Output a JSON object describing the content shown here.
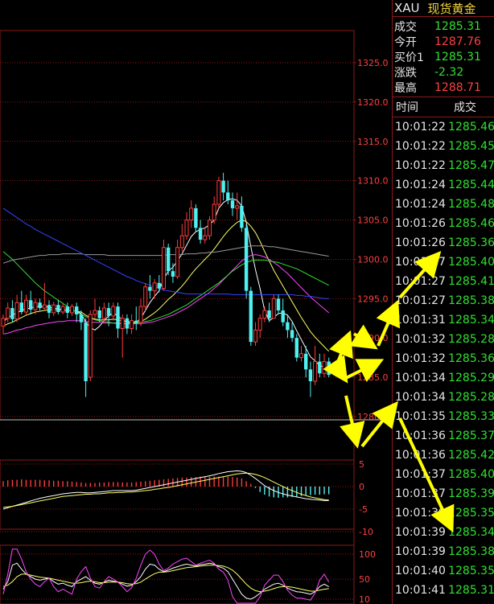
{
  "axis": {
    "main_ticks": [
      "1325.0",
      "1320.0",
      "1315.0",
      "1310.0",
      "1305.0",
      "1300.0",
      "1295.0",
      "1290.0",
      "1285.0",
      "1280.0"
    ],
    "macd_ticks": [
      "5",
      "0",
      "-5",
      "-10"
    ],
    "kdj_ticks": [
      "100",
      "50",
      "10"
    ]
  },
  "panel": {
    "symbol": "XAU",
    "name": "现货黄金",
    "quotes": [
      {
        "label": "成交",
        "value": "1285.31",
        "color": "#33e033"
      },
      {
        "label": "今开",
        "value": "1287.76",
        "color": "#ff4040"
      },
      {
        "label": "买价1",
        "value": "1285.31",
        "color": "#33e033"
      },
      {
        "label": "涨跌",
        "value": "-2.32",
        "color": "#33e033"
      },
      {
        "label": "最高",
        "value": "1288.71",
        "color": "#ff4040"
      }
    ],
    "ticks_header": {
      "time": "时间",
      "price": "成交"
    },
    "ticks": [
      {
        "time": "10:01:22",
        "price": "1285.46"
      },
      {
        "time": "10:01:22",
        "price": "1285.45"
      },
      {
        "time": "10:01:22",
        "price": "1285.47"
      },
      {
        "time": "10:01:24",
        "price": "1285.44"
      },
      {
        "time": "10:01:24",
        "price": "1285.48"
      },
      {
        "time": "10:01:26",
        "price": "1285.46"
      },
      {
        "time": "10:01:26",
        "price": "1285.36"
      },
      {
        "time": "10:01:27",
        "price": "1285.40"
      },
      {
        "time": "10:01:27",
        "price": "1285.41"
      },
      {
        "time": "10:01:27",
        "price": "1285.38"
      },
      {
        "time": "10:01:31",
        "price": "1285.34"
      },
      {
        "time": "10:01:32",
        "price": "1285.28"
      },
      {
        "time": "10:01:32",
        "price": "1285.36"
      },
      {
        "time": "10:01:34",
        "price": "1285.29"
      },
      {
        "time": "10:01:34",
        "price": "1285.28"
      },
      {
        "time": "10:01:35",
        "price": "1285.33"
      },
      {
        "time": "10:01:36",
        "price": "1285.37"
      },
      {
        "time": "10:01:36",
        "price": "1285.42"
      },
      {
        "time": "10:01:37",
        "price": "1285.40"
      },
      {
        "time": "10:01:37",
        "price": "1285.39"
      },
      {
        "time": "10:01:39",
        "price": "1285.35"
      },
      {
        "time": "10:01:39",
        "price": "1285.34"
      },
      {
        "time": "10:01:39",
        "price": "1285.38"
      },
      {
        "time": "10:01:40",
        "price": "1285.35"
      },
      {
        "time": "10:01:41",
        "price": "1285.31"
      }
    ]
  },
  "colors": {
    "up": "#ff3b3b",
    "down": "#4ff0f0",
    "grid": "#8b1a1a",
    "ma_white": "#ffffff",
    "ma_yellow": "#ffff66",
    "ma_magenta": "#ff44ff",
    "ma_green": "#33dd33",
    "ma_gray": "#999999",
    "ma_blue": "#3344ff",
    "arrow": "#ffff00"
  },
  "candles": [
    {
      "o": 1291.5,
      "c": 1292.5,
      "h": 1293,
      "l": 1290.5
    },
    {
      "o": 1292.5,
      "c": 1293.8,
      "h": 1294.5,
      "l": 1292
    },
    {
      "o": 1293.8,
      "c": 1292.4,
      "h": 1294.8,
      "l": 1292
    },
    {
      "o": 1292.4,
      "c": 1294.5,
      "h": 1295.5,
      "l": 1292
    },
    {
      "o": 1294.5,
      "c": 1293.3,
      "h": 1296,
      "l": 1293
    },
    {
      "o": 1293.3,
      "c": 1294.8,
      "h": 1295.5,
      "l": 1293
    },
    {
      "o": 1294.8,
      "c": 1293.6,
      "h": 1296,
      "l": 1293
    },
    {
      "o": 1293.6,
      "c": 1294.5,
      "h": 1295,
      "l": 1293
    },
    {
      "o": 1294.5,
      "c": 1293.8,
      "h": 1295,
      "l": 1293.5
    },
    {
      "o": 1293.8,
      "c": 1294.2,
      "h": 1297,
      "l": 1293.5
    },
    {
      "o": 1294.2,
      "c": 1293.2,
      "h": 1294.8,
      "l": 1292.5
    },
    {
      "o": 1293.2,
      "c": 1294.2,
      "h": 1294.6,
      "l": 1292.8
    },
    {
      "o": 1294.2,
      "c": 1293.3,
      "h": 1294.8,
      "l": 1293
    },
    {
      "o": 1293.3,
      "c": 1294,
      "h": 1294.5,
      "l": 1293
    },
    {
      "o": 1294,
      "c": 1293.2,
      "h": 1294.5,
      "l": 1292.5
    },
    {
      "o": 1293.2,
      "c": 1294,
      "h": 1294.3,
      "l": 1292.8
    },
    {
      "o": 1294,
      "c": 1293,
      "h": 1294.5,
      "l": 1292
    },
    {
      "o": 1293,
      "c": 1292,
      "h": 1293.5,
      "l": 1291
    },
    {
      "o": 1292,
      "c": 1284.5,
      "h": 1292.5,
      "l": 1282.5
    },
    {
      "o": 1285,
      "c": 1293,
      "h": 1293.5,
      "l": 1284.5
    },
    {
      "o": 1293,
      "c": 1293.5,
      "h": 1295,
      "l": 1292.5
    },
    {
      "o": 1293.5,
      "c": 1292.5,
      "h": 1294,
      "l": 1292
    },
    {
      "o": 1292.5,
      "c": 1293.8,
      "h": 1294.5,
      "l": 1292
    },
    {
      "o": 1293.8,
      "c": 1292.8,
      "h": 1294.5,
      "l": 1291.5
    },
    {
      "o": 1292.8,
      "c": 1294,
      "h": 1294.5,
      "l": 1292.2
    },
    {
      "o": 1294,
      "c": 1291.2,
      "h": 1294.5,
      "l": 1290
    },
    {
      "o": 1291.2,
      "c": 1292.5,
      "h": 1293,
      "l": 1287.5
    },
    {
      "o": 1292.5,
      "c": 1291.2,
      "h": 1293,
      "l": 1290.5
    },
    {
      "o": 1291.2,
      "c": 1292.2,
      "h": 1293,
      "l": 1290.5
    },
    {
      "o": 1292.2,
      "c": 1292,
      "h": 1294,
      "l": 1291
    },
    {
      "o": 1292,
      "c": 1294,
      "h": 1295,
      "l": 1291.5
    },
    {
      "o": 1294,
      "c": 1296.5,
      "h": 1297,
      "l": 1293.5
    },
    {
      "o": 1296.5,
      "c": 1296,
      "h": 1298,
      "l": 1295
    },
    {
      "o": 1296,
      "c": 1297,
      "h": 1297.5,
      "l": 1295
    },
    {
      "o": 1297,
      "c": 1296.3,
      "h": 1298,
      "l": 1295.8
    },
    {
      "o": 1296.3,
      "c": 1301.5,
      "h": 1302.5,
      "l": 1296
    },
    {
      "o": 1301.5,
      "c": 1298.5,
      "h": 1302,
      "l": 1298
    },
    {
      "o": 1298.5,
      "c": 1297.8,
      "h": 1299.5,
      "l": 1297
    },
    {
      "o": 1297.8,
      "c": 1301.5,
      "h": 1302.5,
      "l": 1297.5
    },
    {
      "o": 1301.5,
      "c": 1303,
      "h": 1304.5,
      "l": 1301
    },
    {
      "o": 1303,
      "c": 1305,
      "h": 1306,
      "l": 1302.5
    },
    {
      "o": 1305,
      "c": 1306.5,
      "h": 1307.5,
      "l": 1304
    },
    {
      "o": 1306.5,
      "c": 1304,
      "h": 1307,
      "l": 1303.5
    },
    {
      "o": 1304,
      "c": 1302.5,
      "h": 1305,
      "l": 1302
    },
    {
      "o": 1302.5,
      "c": 1303,
      "h": 1304,
      "l": 1302
    },
    {
      "o": 1303,
      "c": 1305,
      "h": 1305.5,
      "l": 1302.5
    },
    {
      "o": 1305,
      "c": 1307,
      "h": 1308,
      "l": 1304.5
    },
    {
      "o": 1307,
      "c": 1310,
      "h": 1310.5,
      "l": 1306.5
    },
    {
      "o": 1310,
      "c": 1308.5,
      "h": 1311,
      "l": 1307.5
    },
    {
      "o": 1308.5,
      "c": 1307.5,
      "h": 1310,
      "l": 1307
    },
    {
      "o": 1307.5,
      "c": 1306.5,
      "h": 1308.5,
      "l": 1305.5
    },
    {
      "o": 1306.5,
      "c": 1306.8,
      "h": 1308.5,
      "l": 1305
    },
    {
      "o": 1306.8,
      "c": 1304,
      "h": 1308,
      "l": 1303.5
    },
    {
      "o": 1304,
      "c": 1296,
      "h": 1304.5,
      "l": 1295
    },
    {
      "o": 1296,
      "c": 1289.5,
      "h": 1296.5,
      "l": 1289
    },
    {
      "o": 1289.5,
      "c": 1291,
      "h": 1292,
      "l": 1289
    },
    {
      "o": 1291,
      "c": 1292.5,
      "h": 1293,
      "l": 1290
    },
    {
      "o": 1292.5,
      "c": 1293.5,
      "h": 1294,
      "l": 1292
    },
    {
      "o": 1293.5,
      "c": 1292.5,
      "h": 1294.5,
      "l": 1292
    },
    {
      "o": 1292.5,
      "c": 1295,
      "h": 1295.5,
      "l": 1292.5
    },
    {
      "o": 1295,
      "c": 1293.5,
      "h": 1295.5,
      "l": 1293
    },
    {
      "o": 1293.5,
      "c": 1292,
      "h": 1295,
      "l": 1291.5
    },
    {
      "o": 1292,
      "c": 1291,
      "h": 1293,
      "l": 1290
    },
    {
      "o": 1291,
      "c": 1290,
      "h": 1292,
      "l": 1289.5
    },
    {
      "o": 1290,
      "c": 1287.5,
      "h": 1290.5,
      "l": 1287
    },
    {
      "o": 1287.5,
      "c": 1288,
      "h": 1289,
      "l": 1287
    },
    {
      "o": 1288,
      "c": 1286,
      "h": 1289,
      "l": 1285
    },
    {
      "o": 1286,
      "c": 1284.5,
      "h": 1287,
      "l": 1282.5
    },
    {
      "o": 1284.5,
      "c": 1287,
      "h": 1289,
      "l": 1284
    },
    {
      "o": 1287,
      "c": 1285.5,
      "h": 1288,
      "l": 1285
    },
    {
      "o": 1285.5,
      "c": 1287,
      "h": 1288,
      "l": 1285
    },
    {
      "o": 1287,
      "c": 1285.3,
      "h": 1287.5,
      "l": 1285
    }
  ],
  "ma_series": {
    "white": [
      1292,
      1292.6,
      1292.9,
      1293.2,
      1293.5,
      1293.7,
      1293.8,
      1294,
      1294,
      1294,
      1293.9,
      1293.8,
      1293.7,
      1293.6,
      1293.5,
      1293.5,
      1293.4,
      1293.1,
      1292,
      1291.3,
      1291,
      1291.5,
      1292.2,
      1292.8,
      1293.2,
      1292.8,
      1292.3,
      1292,
      1291.9,
      1292,
      1292.5,
      1293.5,
      1294.5,
      1295.3,
      1296,
      1297.5,
      1298.5,
      1299,
      1299.8,
      1300.7,
      1301.8,
      1302.9,
      1303.5,
      1303.8,
      1304,
      1304.4,
      1305,
      1306.5,
      1307.2,
      1307.6,
      1307.7,
      1307.5,
      1306.8,
      1304.7,
      1301.6,
      1298.7,
      1296.3,
      1293.5,
      1292.2,
      1292.6,
      1293.1,
      1293.2,
      1292.9,
      1292.1,
      1290.9,
      1289.8,
      1288.7,
      1287.6,
      1287.1,
      1286.5,
      1286.3,
      1286
    ],
    "yellow": [
      1291.5,
      1291.8,
      1292,
      1292.3,
      1292.6,
      1292.9,
      1293.1,
      1293.3,
      1293.4,
      1293.5,
      1293.6,
      1293.6,
      1293.6,
      1293.6,
      1293.5,
      1293.5,
      1293.4,
      1293.3,
      1292.9,
      1292.6,
      1292.4,
      1292.3,
      1292.3,
      1292.3,
      1292.4,
      1292.3,
      1292.2,
      1292.1,
      1292,
      1292,
      1292.1,
      1292.4,
      1292.8,
      1293.2,
      1293.7,
      1294.3,
      1294.9,
      1295.4,
      1296,
      1296.6,
      1297.3,
      1298.1,
      1298.8,
      1299.4,
      1300,
      1300.6,
      1301.3,
      1302.1,
      1302.9,
      1303.6,
      1304.2,
      1304.7,
      1305,
      1304.8,
      1304.2,
      1303.4,
      1302.3,
      1301,
      1299.8,
      1298.6,
      1297.6,
      1296.6,
      1295.6,
      1294.6,
      1293.6,
      1292.6,
      1291.7,
      1290.8,
      1290.1,
      1289.5,
      1288.9,
      1288.3
    ],
    "magenta": [
      1290.5,
      1290.6,
      1290.8,
      1291,
      1291.1,
      1291.3,
      1291.4,
      1291.6,
      1291.7,
      1291.8,
      1291.9,
      1292,
      1292.1,
      1292.1,
      1292.2,
      1292.2,
      1292.2,
      1292.2,
      1292.1,
      1292,
      1292,
      1292,
      1291.9,
      1291.9,
      1291.9,
      1291.9,
      1291.9,
      1291.8,
      1291.8,
      1291.8,
      1291.8,
      1291.9,
      1292,
      1292.1,
      1292.3,
      1292.5,
      1292.7,
      1292.9,
      1293.2,
      1293.5,
      1293.8,
      1294.2,
      1294.6,
      1295,
      1295.4,
      1295.8,
      1296.3,
      1296.8,
      1297.4,
      1298,
      1298.6,
      1299.2,
      1299.8,
      1300.2,
      1300.5,
      1300.6,
      1300.5,
      1300.3,
      1300,
      1299.6,
      1299.2,
      1298.7,
      1298.2,
      1297.6,
      1297,
      1296.4,
      1295.8,
      1295.2,
      1294.7,
      1294.2,
      1293.7,
      1293.2
    ],
    "green": [
      1301,
      1300.5,
      1300,
      1299.4,
      1298.8,
      1298.2,
      1297.6,
      1297,
      1296.5,
      1296,
      1295.6,
      1295.2,
      1294.8,
      1294.4,
      1294,
      1293.6,
      1293.3,
      1293,
      1292.7,
      1292.5,
      1292.3,
      1292.2,
      1292.1,
      1292,
      1291.9,
      1291.8,
      1291.8,
      1291.8,
      1291.8,
      1291.9,
      1292,
      1292.1,
      1292.2,
      1292.4,
      1292.6,
      1292.8,
      1293,
      1293.3,
      1293.6,
      1293.9,
      1294.2,
      1294.6,
      1295,
      1295.4,
      1295.8,
      1296.2,
      1296.6,
      1297,
      1297.5,
      1298,
      1298.5,
      1298.9,
      1299.3,
      1299.6,
      1299.8,
      1299.9,
      1299.9,
      1299.9,
      1299.8,
      1299.7,
      1299.6,
      1299.4,
      1299.2,
      1299,
      1298.8,
      1298.5,
      1298.2,
      1297.9,
      1297.6,
      1297.3,
      1297,
      1296.7
    ],
    "gray": [
      1299.5,
      1299.7,
      1299.9,
      1300,
      1300.1,
      1300.2,
      1300.3,
      1300.4,
      1300.5,
      1300.5,
      1300.6,
      1300.6,
      1300.6,
      1300.7,
      1300.7,
      1300.7,
      1300.7,
      1300.7,
      1300.6,
      1300.6,
      1300.6,
      1300.6,
      1300.6,
      1300.5,
      1300.5,
      1300.5,
      1300.5,
      1300.5,
      1300.5,
      1300.5,
      1300.5,
      1300.5,
      1300.5,
      1300.5,
      1300.5,
      1300.5,
      1300.6,
      1300.6,
      1300.6,
      1300.6,
      1300.7,
      1300.7,
      1300.7,
      1300.8,
      1300.8,
      1300.9,
      1300.9,
      1301,
      1301.1,
      1301.2,
      1301.3,
      1301.4,
      1301.5,
      1301.6,
      1301.7,
      1301.7,
      1301.7,
      1301.7,
      1301.6,
      1301.6,
      1301.5,
      1301.4,
      1301.3,
      1301.2,
      1301.1,
      1301,
      1300.9,
      1300.8,
      1300.7,
      1300.6,
      1300.5,
      1300.4
    ],
    "blue": [
      1306.5,
      1306.1,
      1305.7,
      1305.3,
      1304.9,
      1304.5,
      1304.2,
      1303.8,
      1303.5,
      1303.2,
      1302.9,
      1302.6,
      1302.3,
      1302,
      1301.7,
      1301.4,
      1301.1,
      1300.8,
      1300.5,
      1300.2,
      1299.9,
      1299.6,
      1299.3,
      1299,
      1298.7,
      1298.4,
      1298.1,
      1297.8,
      1297.6,
      1297.3,
      1297.1,
      1296.9,
      1296.7,
      1296.5,
      1296.3,
      1296.1,
      1296,
      1295.9,
      1295.8,
      1295.7,
      1295.6,
      1295.6,
      1295.6,
      1295.6,
      1295.6,
      1295.6,
      1295.6,
      1295.6,
      1295.6,
      1295.6,
      1295.5,
      1295.5,
      1295.5,
      1295.5,
      1295.5,
      1295.5,
      1295.5,
      1295.5,
      1295.5,
      1295.5,
      1295.5,
      1295.5,
      1295.5,
      1295.5,
      1295.4,
      1295.4,
      1295.3,
      1295.3,
      1295.2,
      1295.1,
      1295,
      1295
    ]
  },
  "macd": {
    "hist": [
      1.2,
      1.4,
      1.5,
      1.5,
      1.6,
      1.5,
      1.5,
      1.5,
      1.5,
      1.4,
      1.4,
      1.3,
      1.3,
      1.2,
      1.2,
      1.1,
      1,
      0.9,
      0.8,
      0.8,
      0.8,
      0.9,
      0.9,
      1,
      1,
      1,
      0.9,
      0.9,
      0.9,
      1,
      1.1,
      1.2,
      1.3,
      1.4,
      1.5,
      1.6,
      1.7,
      1.8,
      1.9,
      2,
      2,
      2.1,
      2.1,
      2.2,
      2.2,
      2.2,
      2.2,
      2.2,
      2.2,
      2.2,
      2.1,
      2,
      1.8,
      1.2,
      0.6,
      -0.3,
      -1.2,
      -1.8,
      -2.2,
      -2.4,
      -2.5,
      -2.4,
      -2.4,
      -2.3,
      -2.2,
      -2.1,
      -2,
      -1.9,
      -1.8,
      -1.8,
      -1.7,
      -1.7
    ],
    "dif": [
      -5,
      -4.7,
      -4.4,
      -4.1,
      -3.8,
      -3.5,
      -3.2,
      -2.9,
      -2.6,
      -2.4,
      -2.2,
      -2,
      -1.8,
      -1.6,
      -1.5,
      -1.4,
      -1.3,
      -1.3,
      -1.4,
      -1.4,
      -1.3,
      -1.2,
      -1.1,
      -1,
      -0.9,
      -0.9,
      -0.9,
      -0.9,
      -0.9,
      -0.8,
      -0.6,
      -0.4,
      -0.2,
      0,
      0.2,
      0.4,
      0.6,
      0.8,
      1,
      1.2,
      1.4,
      1.6,
      1.8,
      2,
      2.2,
      2.4,
      2.6,
      2.9,
      3.1,
      3.3,
      3.4,
      3.5,
      3.4,
      3.1,
      2.5,
      1.8,
      1,
      0.2,
      -0.4,
      -0.9,
      -1.3,
      -1.6,
      -1.9,
      -2.1,
      -2.3,
      -2.5,
      -2.7,
      -2.8,
      -2.9,
      -3,
      -3.1,
      -3.1
    ],
    "dea": [
      -4.6,
      -4.5,
      -4.4,
      -4.2,
      -4,
      -3.8,
      -3.6,
      -3.4,
      -3.2,
      -3,
      -2.8,
      -2.6,
      -2.4,
      -2.2,
      -2.1,
      -2,
      -1.9,
      -1.8,
      -1.7,
      -1.7,
      -1.6,
      -1.6,
      -1.5,
      -1.4,
      -1.4,
      -1.3,
      -1.3,
      -1.2,
      -1.2,
      -1.1,
      -1,
      -0.9,
      -0.8,
      -0.6,
      -0.5,
      -0.3,
      -0.2,
      0,
      0.2,
      0.4,
      0.6,
      0.8,
      1,
      1.2,
      1.4,
      1.6,
      1.8,
      2,
      2.2,
      2.4,
      2.6,
      2.8,
      2.9,
      3,
      2.9,
      2.7,
      2.4,
      2,
      1.5,
      1,
      0.5,
      0,
      -0.5,
      -0.9,
      -1.3,
      -1.7,
      -2,
      -2.3,
      -2.5,
      -2.7,
      -2.9,
      -3
    ]
  },
  "kdj": {
    "k": [
      30,
      45,
      78,
      82,
      70,
      60,
      55,
      50,
      48,
      50,
      52,
      45,
      40,
      42,
      38,
      35,
      45,
      50,
      55,
      48,
      42,
      40,
      44,
      48,
      46,
      44,
      40,
      36,
      38,
      45,
      55,
      70,
      80,
      78,
      70,
      65,
      68,
      72,
      75,
      78,
      80,
      78,
      76,
      79,
      80,
      82,
      80,
      75,
      72,
      65,
      50,
      35,
      20,
      12,
      10,
      15,
      22,
      30,
      35,
      40,
      42,
      38,
      32,
      28,
      25,
      24,
      22,
      20,
      25,
      35,
      40,
      35
    ],
    "d": [
      35,
      38,
      45,
      55,
      60,
      60,
      58,
      56,
      54,
      53,
      52,
      50,
      48,
      46,
      44,
      42,
      42,
      43,
      45,
      46,
      45,
      43,
      43,
      44,
      44,
      44,
      43,
      41,
      40,
      41,
      44,
      50,
      56,
      61,
      64,
      64,
      65,
      67,
      69,
      71,
      73,
      74,
      75,
      76,
      77,
      78,
      78,
      77,
      76,
      73,
      68,
      60,
      50,
      40,
      32,
      27,
      25,
      26,
      28,
      31,
      34,
      35,
      35,
      34,
      32,
      30,
      28,
      26,
      26,
      28,
      30,
      31
    ],
    "j": [
      20,
      60,
      110,
      110,
      90,
      65,
      50,
      40,
      35,
      45,
      52,
      35,
      25,
      30,
      25,
      20,
      50,
      65,
      75,
      52,
      35,
      32,
      45,
      55,
      50,
      44,
      35,
      25,
      33,
      52,
      78,
      100,
      108,
      100,
      80,
      67,
      72,
      80,
      85,
      90,
      92,
      85,
      78,
      82,
      85,
      88,
      82,
      70,
      64,
      48,
      15,
      0,
      0,
      0,
      0,
      0,
      15,
      38,
      48,
      58,
      58,
      45,
      28,
      18,
      12,
      12,
      10,
      8,
      22,
      48,
      60,
      44
    ]
  }
}
